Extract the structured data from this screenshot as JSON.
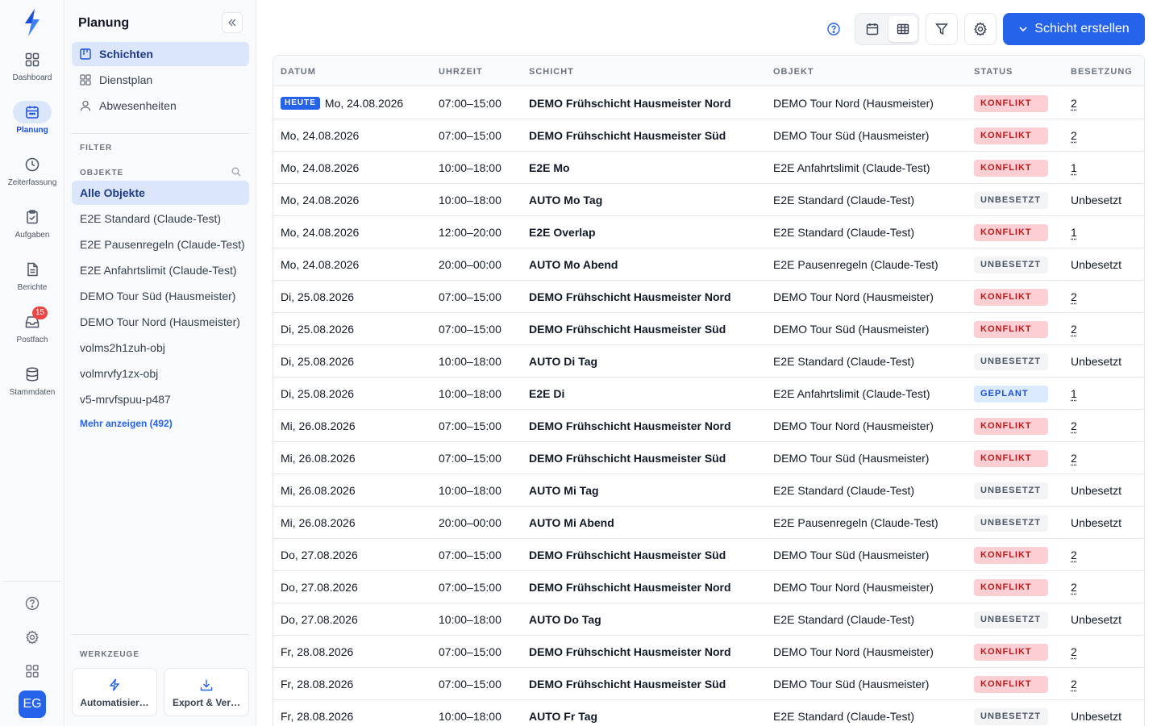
{
  "rail": {
    "items": [
      {
        "label": "Dashboard"
      },
      {
        "label": "Planung"
      },
      {
        "label": "Zeiterfassung"
      },
      {
        "label": "Aufgaben"
      },
      {
        "label": "Berichte"
      },
      {
        "label": "Postfach",
        "badge": "15"
      },
      {
        "label": "Stammdaten"
      }
    ],
    "avatar": "EG",
    "accent": "#2563eb"
  },
  "sidebar": {
    "title": "Planung",
    "nav": [
      {
        "label": "Schichten",
        "icon": "board-icon",
        "active": true
      },
      {
        "label": "Dienstplan",
        "icon": "grid-icon"
      },
      {
        "label": "Abwesenheiten",
        "icon": "user-icon"
      }
    ],
    "filter_label": "FILTER",
    "objects_label": "OBJEKTE",
    "objects": [
      "Alle Objekte",
      "E2E Standard (Claude-Test)",
      "E2E Pausenregeln (Claude-Test)",
      "E2E Anfahrtslimit (Claude-Test)",
      "DEMO Tour Süd (Hausmeister)",
      "DEMO Tour Nord (Hausmeister)",
      "volms2h1zuh-obj",
      "volmrvfy1zx-obj",
      "v5-mrvfspuu-p487"
    ],
    "more_link": "Mehr anzeigen (492)",
    "tools_label": "WERKZEUGE",
    "tools": [
      "Automatisier…",
      "Export & Ver…"
    ]
  },
  "toolbar": {
    "create_label": "Schicht erstellen"
  },
  "table": {
    "headers": [
      "DATUM",
      "UHRZEIT",
      "SCHICHT",
      "OBJEKT",
      "STATUS",
      "BESETZUNG"
    ],
    "today_label": "HEUTE",
    "rows": [
      {
        "date": "Mo, 24.08.2026",
        "today": true,
        "time": "07:00–15:00",
        "shift": "DEMO Frühschicht Hausmeister Nord",
        "object": "DEMO Tour Nord (Hausmeister)",
        "status": "KONFLIKT",
        "occupancy": "2"
      },
      {
        "date": "Mo, 24.08.2026",
        "time": "07:00–15:00",
        "shift": "DEMO Frühschicht Hausmeister Süd",
        "object": "DEMO Tour Süd (Hausmeister)",
        "status": "KONFLIKT",
        "occupancy": "2"
      },
      {
        "date": "Mo, 24.08.2026",
        "time": "10:00–18:00",
        "shift": "E2E Mo",
        "object": "E2E Anfahrtslimit (Claude-Test)",
        "status": "KONFLIKT",
        "occupancy": "1"
      },
      {
        "date": "Mo, 24.08.2026",
        "time": "10:00–18:00",
        "shift": "AUTO Mo Tag",
        "object": "E2E Standard (Claude-Test)",
        "status": "UNBESETZT",
        "occupancy": "Unbesetzt"
      },
      {
        "date": "Mo, 24.08.2026",
        "time": "12:00–20:00",
        "shift": "E2E Overlap",
        "object": "E2E Standard (Claude-Test)",
        "status": "KONFLIKT",
        "occupancy": "1"
      },
      {
        "date": "Mo, 24.08.2026",
        "time": "20:00–00:00",
        "shift": "AUTO Mo Abend",
        "object": "E2E Pausenregeln (Claude-Test)",
        "status": "UNBESETZT",
        "occupancy": "Unbesetzt"
      },
      {
        "date": "Di, 25.08.2026",
        "time": "07:00–15:00",
        "shift": "DEMO Frühschicht Hausmeister Nord",
        "object": "DEMO Tour Nord (Hausmeister)",
        "status": "KONFLIKT",
        "occupancy": "2"
      },
      {
        "date": "Di, 25.08.2026",
        "time": "07:00–15:00",
        "shift": "DEMO Frühschicht Hausmeister Süd",
        "object": "DEMO Tour Süd (Hausmeister)",
        "status": "KONFLIKT",
        "occupancy": "2"
      },
      {
        "date": "Di, 25.08.2026",
        "time": "10:00–18:00",
        "shift": "AUTO Di Tag",
        "object": "E2E Standard (Claude-Test)",
        "status": "UNBESETZT",
        "occupancy": "Unbesetzt"
      },
      {
        "date": "Di, 25.08.2026",
        "time": "10:00–18:00",
        "shift": "E2E Di",
        "object": "E2E Anfahrtslimit (Claude-Test)",
        "status": "GEPLANT",
        "occupancy": "1"
      },
      {
        "date": "Mi, 26.08.2026",
        "time": "07:00–15:00",
        "shift": "DEMO Frühschicht Hausmeister Nord",
        "object": "DEMO Tour Nord (Hausmeister)",
        "status": "KONFLIKT",
        "occupancy": "2"
      },
      {
        "date": "Mi, 26.08.2026",
        "time": "07:00–15:00",
        "shift": "DEMO Frühschicht Hausmeister Süd",
        "object": "DEMO Tour Süd (Hausmeister)",
        "status": "KONFLIKT",
        "occupancy": "2"
      },
      {
        "date": "Mi, 26.08.2026",
        "time": "10:00–18:00",
        "shift": "AUTO Mi Tag",
        "object": "E2E Standard (Claude-Test)",
        "status": "UNBESETZT",
        "occupancy": "Unbesetzt"
      },
      {
        "date": "Mi, 26.08.2026",
        "time": "20:00–00:00",
        "shift": "AUTO Mi Abend",
        "object": "E2E Pausenregeln (Claude-Test)",
        "status": "UNBESETZT",
        "occupancy": "Unbesetzt"
      },
      {
        "date": "Do, 27.08.2026",
        "time": "07:00–15:00",
        "shift": "DEMO Frühschicht Hausmeister Süd",
        "object": "DEMO Tour Süd (Hausmeister)",
        "status": "KONFLIKT",
        "occupancy": "2"
      },
      {
        "date": "Do, 27.08.2026",
        "time": "07:00–15:00",
        "shift": "DEMO Frühschicht Hausmeister Nord",
        "object": "DEMO Tour Nord (Hausmeister)",
        "status": "KONFLIKT",
        "occupancy": "2"
      },
      {
        "date": "Do, 27.08.2026",
        "time": "10:00–18:00",
        "shift": "AUTO Do Tag",
        "object": "E2E Standard (Claude-Test)",
        "status": "UNBESETZT",
        "occupancy": "Unbesetzt"
      },
      {
        "date": "Fr, 28.08.2026",
        "time": "07:00–15:00",
        "shift": "DEMO Frühschicht Hausmeister Nord",
        "object": "DEMO Tour Nord (Hausmeister)",
        "status": "KONFLIKT",
        "occupancy": "2"
      },
      {
        "date": "Fr, 28.08.2026",
        "time": "07:00–15:00",
        "shift": "DEMO Frühschicht Hausmeister Süd",
        "object": "DEMO Tour Süd (Hausmeister)",
        "status": "KONFLIKT",
        "occupancy": "2"
      },
      {
        "date": "Fr, 28.08.2026",
        "time": "10:00–18:00",
        "shift": "AUTO Fr Tag",
        "object": "E2E Standard (Claude-Test)",
        "status": "UNBESETZT",
        "occupancy": "Unbesetzt"
      }
    ]
  },
  "colors": {
    "konflikt_bg": "#fbcfd3",
    "konflikt_fg": "#b91c1c",
    "geplant_bg": "#dbeafe",
    "unbesetzt_bg": "#f3f4f6"
  }
}
